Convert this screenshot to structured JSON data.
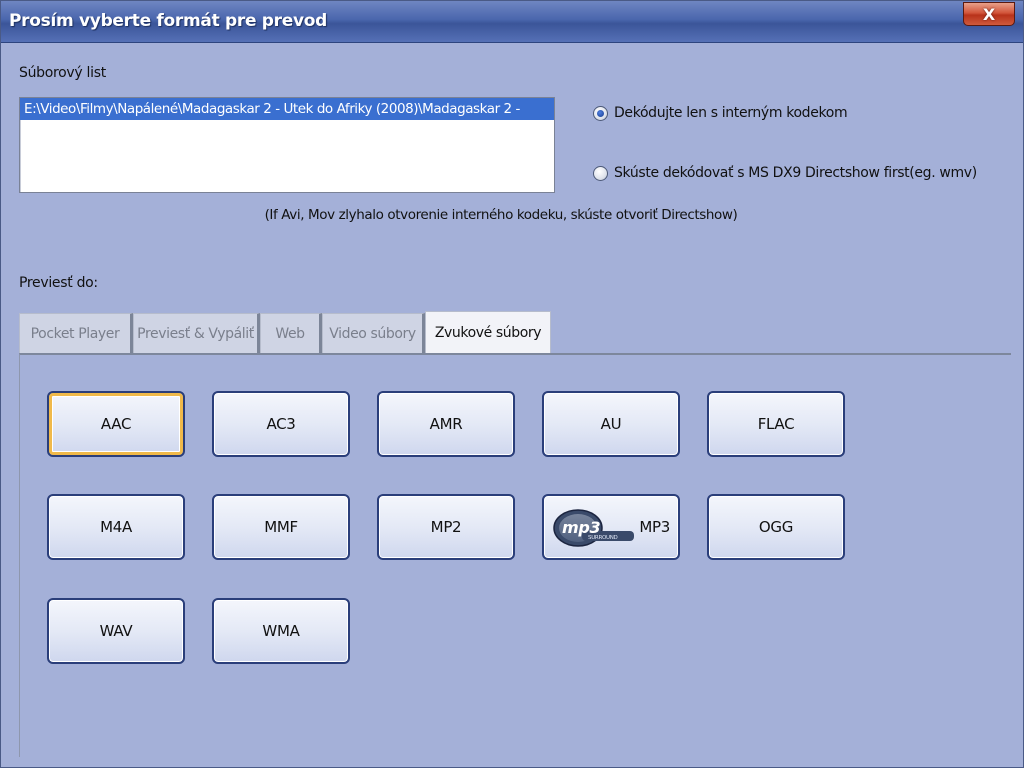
{
  "window": {
    "title": "Prosím vyberte formát pre prevod",
    "close_glyph": "X"
  },
  "file_list": {
    "label": "Súborový list",
    "items": [
      "E:\\Video\\Filmy\\Napálené\\Madagaskar 2 - Utek do Afriky (2008)\\Madagaskar 2 -"
    ]
  },
  "decode_options": [
    {
      "label": "Dekódujte len s interným kodekom",
      "checked": true
    },
    {
      "label": "Skúste dekódovať s MS DX9 Directshow first(eg. wmv)",
      "checked": false
    }
  ],
  "hint": "(If Avi, Mov zlyhalo otvorenie interného kodeku, skúste otvoriť Directshow)",
  "convert_label": "Previesť do:",
  "tabs": [
    {
      "label": "Pocket  Player",
      "active": false
    },
    {
      "label": "Previesť & Vypáliť",
      "active": false
    },
    {
      "label": "Web",
      "active": false
    },
    {
      "label": "Video súbory",
      "active": false
    },
    {
      "label": "Zvukové súbory",
      "active": true
    }
  ],
  "formats": [
    "AAC",
    "AC3",
    "AMR",
    "AU",
    "FLAC",
    "M4A",
    "MMF",
    "MP2",
    "MP3",
    "OGG",
    "WAV",
    "WMA"
  ],
  "mp3_logo": {
    "text": "mp3",
    "subtext": "SURROUND"
  },
  "colors": {
    "window_bg": "#a4b0d8",
    "titlebar": "#4a66ad",
    "selection": "#3a6fd0",
    "focus_ring": "#f0b94a"
  }
}
